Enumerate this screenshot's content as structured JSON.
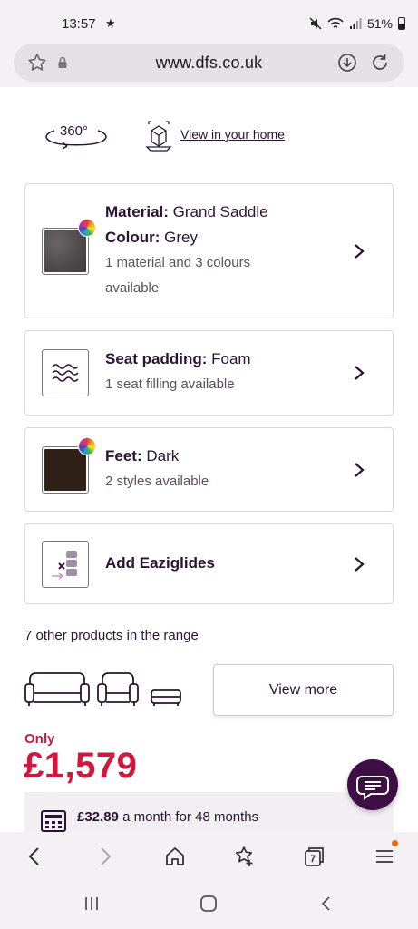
{
  "status_bar": {
    "time": "13:57",
    "battery": "51%"
  },
  "browser": {
    "url": "www.dfs.co.uk",
    "tab_count": "7"
  },
  "view_row": {
    "label_360": "360°",
    "home_link": "View in your home"
  },
  "options": [
    {
      "label": "Material:",
      "value": "Grand Saddle",
      "label2": "Colour:",
      "value2": "Grey",
      "sub": "1 material and 3 colours available",
      "swatch": "#4e4a4b"
    },
    {
      "label": "Seat padding:",
      "value": "Foam",
      "sub": "1 seat filling available"
    },
    {
      "label": "Feet:",
      "value": "Dark",
      "sub": "2 styles available",
      "swatch": "#2f2118"
    },
    {
      "label": "Add Eaziglides"
    }
  ],
  "range": {
    "title": "7 other products in the range",
    "view_more": "View more"
  },
  "price": {
    "only": "Only",
    "amount": "£1,579"
  },
  "finance": {
    "monthly": "£32.89",
    "text": "a month for 48 months"
  },
  "colors": {
    "brand": "#2b1433",
    "price": "#d2173f",
    "chat": "#3d0f45"
  }
}
